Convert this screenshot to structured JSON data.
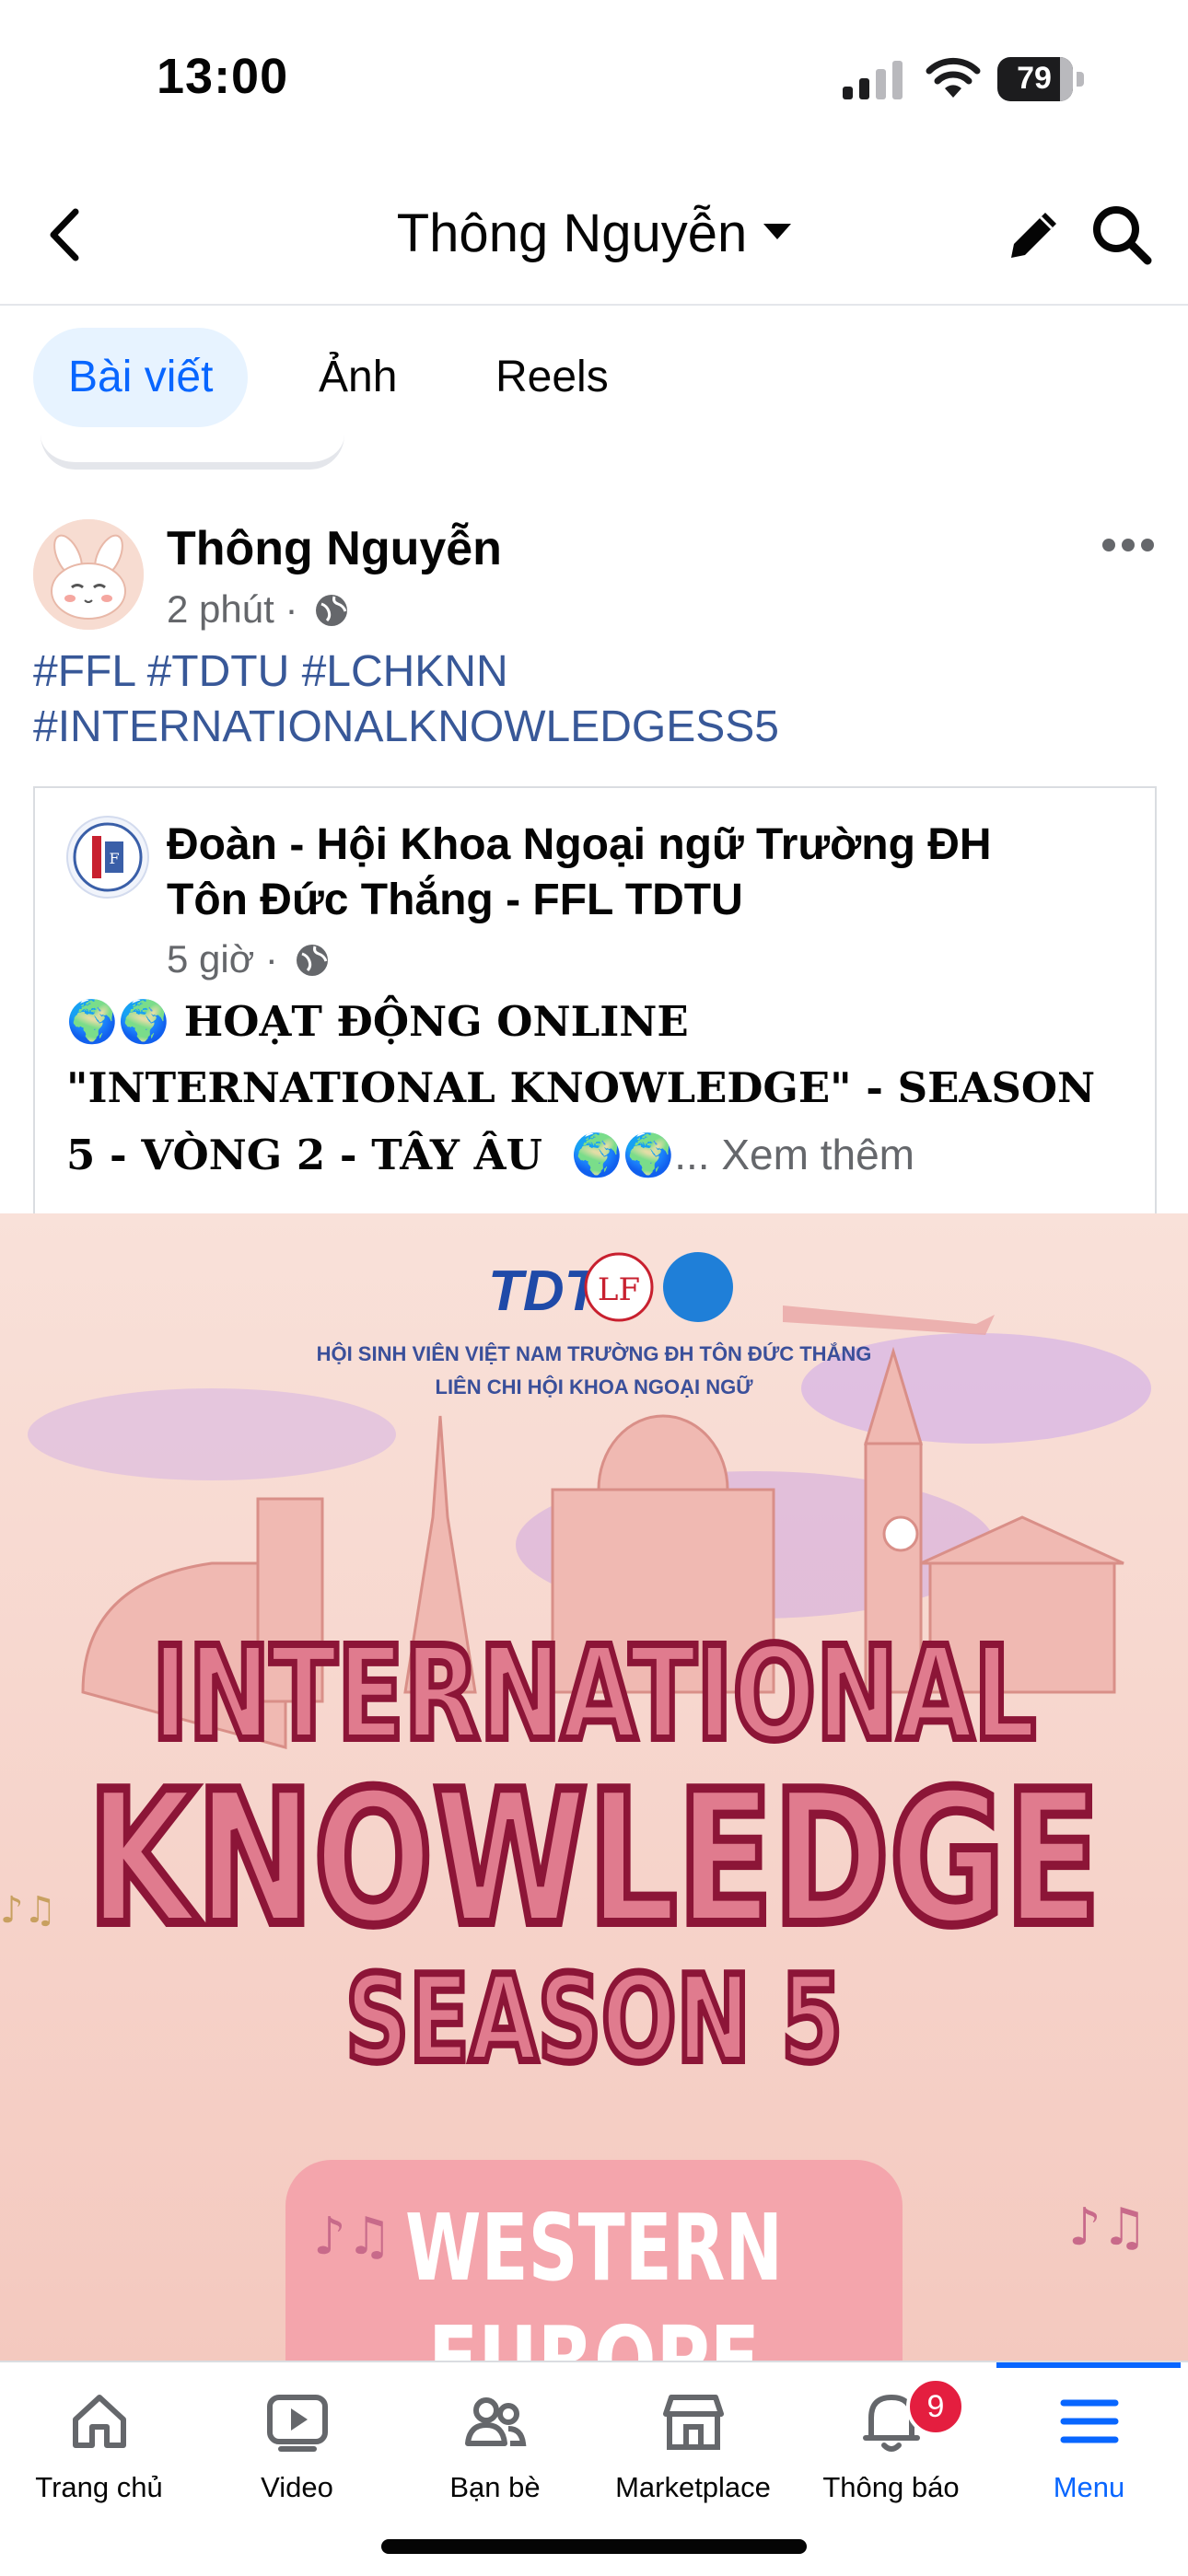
{
  "status_bar": {
    "time": "13:00",
    "battery": "79"
  },
  "header": {
    "title": "Thông Nguyễn",
    "icons": [
      "back-icon",
      "caret-down-icon",
      "edit-icon",
      "search-icon"
    ]
  },
  "tabs": [
    {
      "label": "Bài viết",
      "active": true
    },
    {
      "label": "Ảnh"
    },
    {
      "label": "Reels"
    }
  ],
  "post": {
    "author": "Thông Nguyễn",
    "time": "2 phút",
    "hashtags_line1": "#FFL #TDTU #LCHKNN",
    "hashtags_line2": "#INTERNATIONALKNOWLEDGESS5",
    "shared": {
      "page_line1": "Đoàn - Hội Khoa Ngoại ngữ Trường ĐH",
      "page_line2": "Tôn Đức Thắng - FFL TDTU",
      "time": "5 giờ",
      "text_line1": "HOẠT ĐỘNG ONLINE",
      "text_line2": "\"INTERNATIONAL KNOWLEDGE\" - SEASON",
      "text_line3": "5 - VÒNG 2 - TÂY ÂU",
      "see_more": "Xem thêm",
      "earth_emoji": "🌍"
    }
  },
  "poster": {
    "logo_text": "TDT",
    "logo2": "LF",
    "header_line1": "HỘI SINH VIÊN VIỆT NAM TRƯỜNG ĐH TÔN ĐỨC THẮNG",
    "header_line2": "LIÊN CHI HỘI KHOA NGOẠI NGỮ",
    "title_line1": "INTERNATIONAL",
    "title_line2": "KNOWLEDGE",
    "title_line3": "SEASON 5",
    "subtitle1": "WESTERN",
    "subtitle2": "EUROPE"
  },
  "bottom_nav": [
    {
      "label": "Trang chủ",
      "icon": "home-icon"
    },
    {
      "label": "Video",
      "icon": "video-icon"
    },
    {
      "label": "Bạn bè",
      "icon": "friends-icon"
    },
    {
      "label": "Marketplace",
      "icon": "marketplace-icon"
    },
    {
      "label": "Thông báo",
      "icon": "bell-icon",
      "badge": "9"
    },
    {
      "label": "Menu",
      "icon": "menu-icon",
      "active": true
    }
  ],
  "colors": {
    "accent": "#0866ff",
    "hashtag": "#385898",
    "badge": "#e41e3f",
    "poster_bg": "#f6d5cf",
    "title_fill": "#e07b8e",
    "title_stroke": "#8c1537"
  }
}
